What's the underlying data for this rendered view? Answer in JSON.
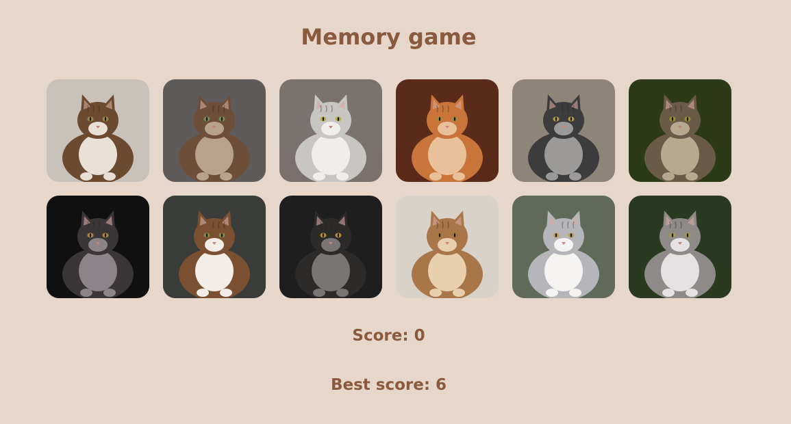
{
  "game": {
    "title": "Memory game",
    "score_label": "Score: 0",
    "best_score_label": "Best score: 6",
    "score": 0,
    "best_score": 6
  },
  "colors": {
    "background": "#e7d7ca",
    "text": "#8a5a3e"
  },
  "cards": [
    {
      "name": "maine-coon-pair-image",
      "bg": "#c9c2bb",
      "fur": "#6b4a30",
      "fur2": "#e9e1d6",
      "eyes": "#9a8a40"
    },
    {
      "name": "fluffy-kitten-image",
      "bg": "#5f5b5a",
      "fur": "#6d4e38",
      "fur2": "#b8a28c",
      "eyes": "#7a8a5a"
    },
    {
      "name": "silver-tabby-image",
      "bg": "#7a726d",
      "fur": "#c8c6c2",
      "fur2": "#f0eeea",
      "eyes": "#b8b040"
    },
    {
      "name": "orange-maine-coon-image",
      "bg": "#5a2a1a",
      "fur": "#c9753a",
      "fur2": "#e8c09a",
      "eyes": "#a88a30"
    },
    {
      "name": "grey-tabby-walking-image",
      "bg": "#8f8478",
      "fur": "#3d3c3c",
      "fur2": "#9c9a98",
      "eyes": "#b0a040"
    },
    {
      "name": "tabby-on-green-image",
      "bg": "#2c3a18",
      "fur": "#6a5a48",
      "fur2": "#b7a890",
      "eyes": "#9a9030"
    },
    {
      "name": "black-smoke-cat-image",
      "bg": "#101010",
      "fur": "#3a3537",
      "fur2": "#8c8488",
      "eyes": "#b08a30"
    },
    {
      "name": "calico-kitten-image",
      "bg": "#3a3c3a",
      "fur": "#7a5030",
      "fur2": "#f2ede6",
      "eyes": "#8a8a40"
    },
    {
      "name": "black-maine-coon-image",
      "bg": "#1e1e1e",
      "fur": "#2d2a2a",
      "fur2": "#7a7575",
      "eyes": "#c09030"
    },
    {
      "name": "red-tabby-lying-image",
      "bg": "#d9d2c8",
      "fur": "#a9764a",
      "fur2": "#e8cfae",
      "eyes": "#a87a30"
    },
    {
      "name": "silver-lying-cat-image",
      "bg": "#5f6a58",
      "fur": "#b6b6ba",
      "fur2": "#f4f3f2",
      "eyes": "#c0a040"
    },
    {
      "name": "grey-cat-snow-image",
      "bg": "#2a3a20",
      "fur": "#8e8a88",
      "fur2": "#e4e2e2",
      "eyes": "#a89a40"
    }
  ]
}
